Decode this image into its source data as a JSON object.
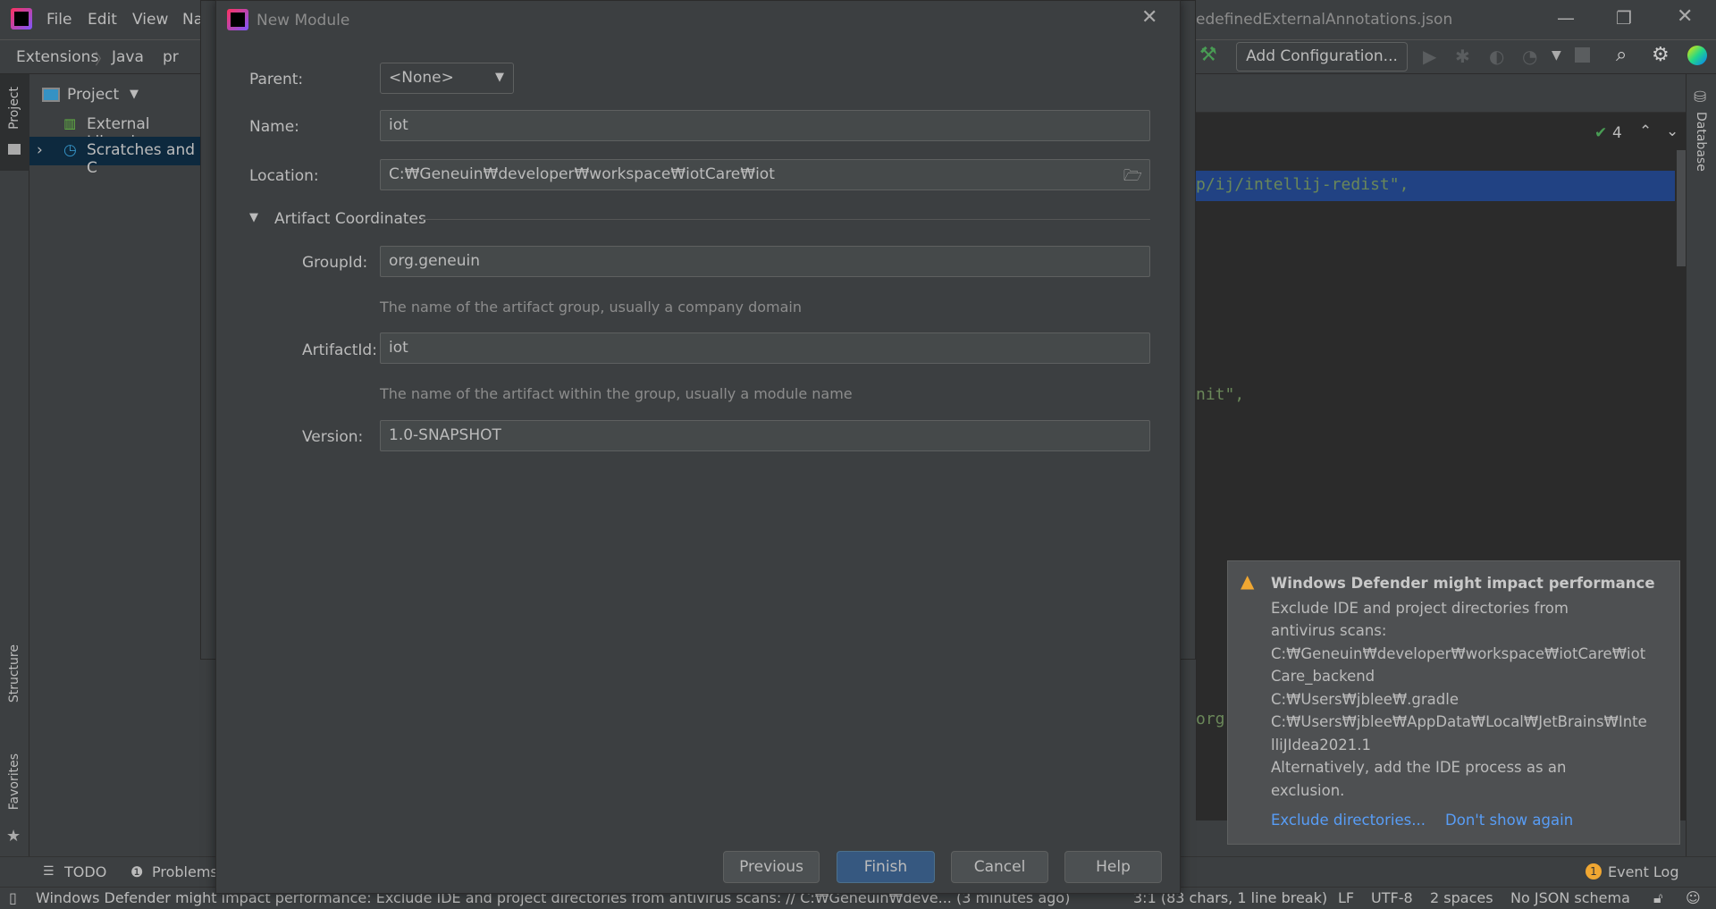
{
  "titlebar": {
    "menu": [
      "File",
      "Edit",
      "View",
      "Na"
    ],
    "file_title": "edefinedExternalAnnotations.json"
  },
  "navbar": {
    "breadcrumb": [
      "Extensions",
      "Java",
      "pr"
    ],
    "add_configuration": "Add Configuration..."
  },
  "left_strip": {
    "project": "Project",
    "structure": "Structure",
    "favorites": "Favorites"
  },
  "project_panel": {
    "header": "Project",
    "items": [
      "External Librarie",
      "Scratches and C"
    ]
  },
  "editor": {
    "inspection_count": "4",
    "lines": [
      "p/ij/intellij-redist\",",
      "nit\",",
      "org.h"
    ]
  },
  "right_strip": {
    "database": "Database"
  },
  "dialog": {
    "title": "New Module",
    "parent_label": "Parent:",
    "parent_value": "<None>",
    "name_label": "Name:",
    "name_value": "iot",
    "location_label": "Location:",
    "location_value": "C:₩Geneuin₩developer₩workspace₩iotCare₩iot",
    "section": "Artifact Coordinates",
    "groupid_label": "GroupId:",
    "groupid_value": "org.geneuin",
    "groupid_hint": "The name of the artifact group, usually a company domain",
    "artifactid_label": "ArtifactId:",
    "artifactid_value": "iot",
    "artifactid_hint": "The name of the artifact within the group, usually a module name",
    "version_label": "Version:",
    "version_value": "1.0-SNAPSHOT",
    "buttons": {
      "previous": "Previous",
      "finish": "Finish",
      "cancel": "Cancel",
      "help": "Help"
    }
  },
  "notification": {
    "title": "Windows Defender might impact performance",
    "lines": [
      "Exclude IDE and project directories from",
      "antivirus scans:",
      "C:₩Geneuin₩developer₩workspace₩iotCare₩iot",
      "Care_backend",
      "C:₩Users₩jblee₩.gradle",
      "C:₩Users₩jblee₩AppData₩Local₩JetBrains₩Inte",
      "lliJIdea2021.1",
      "Alternatively, add the IDE process as an",
      "exclusion."
    ],
    "action_exclude": "Exclude directories...",
    "action_dismiss": "Don't show again"
  },
  "bottom_bar": {
    "todo": "TODO",
    "problems": "Problems",
    "event_log": "Event Log",
    "event_count": "1"
  },
  "status_bar": {
    "message": "Windows Defender might impact performance: Exclude IDE and project directories from antivirus scans: // C:₩Geneuin₩deve... (3 minutes ago)",
    "position": "3:1 (83 chars, 1 line break)",
    "line_sep": "LF",
    "encoding": "UTF-8",
    "indent": "2 spaces",
    "schema": "No JSON schema"
  },
  "colors": {
    "accent": "#365880",
    "selection": "#214283",
    "link": "#589df6",
    "warning": "#f0a732",
    "string": "#6a8759"
  }
}
